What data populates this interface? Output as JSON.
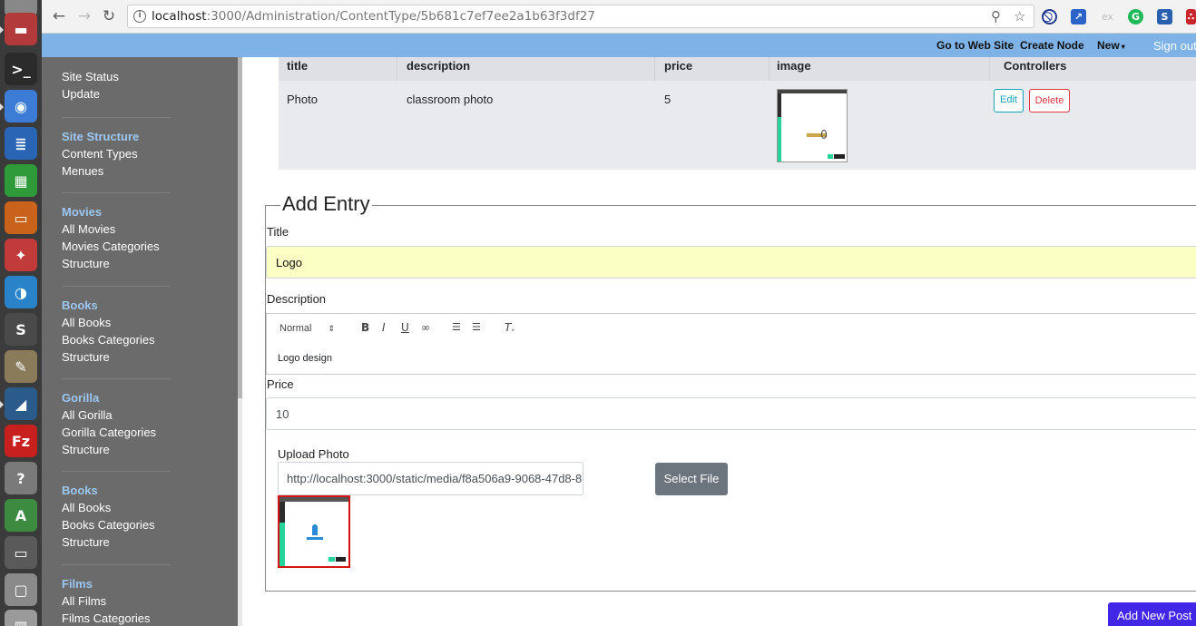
{
  "browser": {
    "url_host": "localhost",
    "url_rest": ":3000/Administration/ContentType/5b681c7ef7ee2a1b63f3df27"
  },
  "launcher": {
    "items": [
      {
        "icon": "app-icon-partial",
        "color": "#888888"
      },
      {
        "icon": "file-manager-icon",
        "color": "#b33a3a"
      },
      {
        "icon": "terminal-icon",
        "color": "#2b2b2b"
      },
      {
        "icon": "chrome-icon",
        "color": "#3d7cd6"
      },
      {
        "icon": "writer-icon",
        "color": "#2a64b5"
      },
      {
        "icon": "calc-icon",
        "color": "#2f9a3a"
      },
      {
        "icon": "impress-icon",
        "color": "#c9621a"
      },
      {
        "icon": "settings-tools-icon",
        "color": "#c23b3b"
      },
      {
        "icon": "remmina-icon",
        "color": "#2a83c9"
      },
      {
        "icon": "sublime-icon",
        "color": "#4a4a4a"
      },
      {
        "icon": "image-viewer-icon",
        "color": "#8a7b5a"
      },
      {
        "icon": "mysql-workbench-icon",
        "color": "#2b5b8a"
      },
      {
        "icon": "filezilla-icon",
        "color": "#c8201f"
      },
      {
        "icon": "help-icon",
        "color": "#7a7a7a"
      },
      {
        "icon": "android-studio-icon",
        "color": "#3d8b40"
      },
      {
        "icon": "display-icon",
        "color": "#5a5a5a"
      },
      {
        "icon": "drive-icon",
        "color": "#8a8a8a"
      },
      {
        "icon": "trash-icon",
        "color": "#9a9a9a"
      }
    ]
  },
  "navbar": {
    "go_to_web_site": "Go to Web Site",
    "create_node": "Create Node",
    "new": "New",
    "sign_out": "Sign out"
  },
  "sidebar": {
    "groups": [
      {
        "heading": "",
        "items": [
          "Site Status",
          "Update"
        ]
      },
      {
        "heading": "Site Structure",
        "items": [
          "Content Types",
          "Menues"
        ]
      },
      {
        "heading": "Movies",
        "items": [
          "All Movies",
          "Movies Categories",
          "Structure"
        ]
      },
      {
        "heading": "Books",
        "items": [
          "All Books",
          "Books Categories",
          "Structure"
        ]
      },
      {
        "heading": "Gorilla",
        "items": [
          "All Gorilla",
          "Gorilla Categories",
          "Structure"
        ]
      },
      {
        "heading": "Books",
        "items": [
          "All Books",
          "Books Categories",
          "Structure"
        ]
      },
      {
        "heading": "Films",
        "items": [
          "All Films",
          "Films Categories"
        ]
      }
    ]
  },
  "table": {
    "headers": [
      "title",
      "description",
      "price",
      "image",
      "Controllers"
    ],
    "rows": [
      {
        "title": "Photo",
        "description": "classroom photo",
        "price": "5",
        "edit": "Edit",
        "delete": "Delete"
      }
    ]
  },
  "form": {
    "legend": "Add Entry",
    "title_label": "Title",
    "title_value": "Logo",
    "description_label": "Description",
    "format_select": "Normal",
    "description_value": "Logo design",
    "price_label": "Price",
    "price_value": "10",
    "upload_label": "Upload Photo",
    "upload_value": "http://localhost:3000/static/media/f8a506a9-9068-47d8-8",
    "select_file": "Select File",
    "submit": "Add New Post"
  }
}
